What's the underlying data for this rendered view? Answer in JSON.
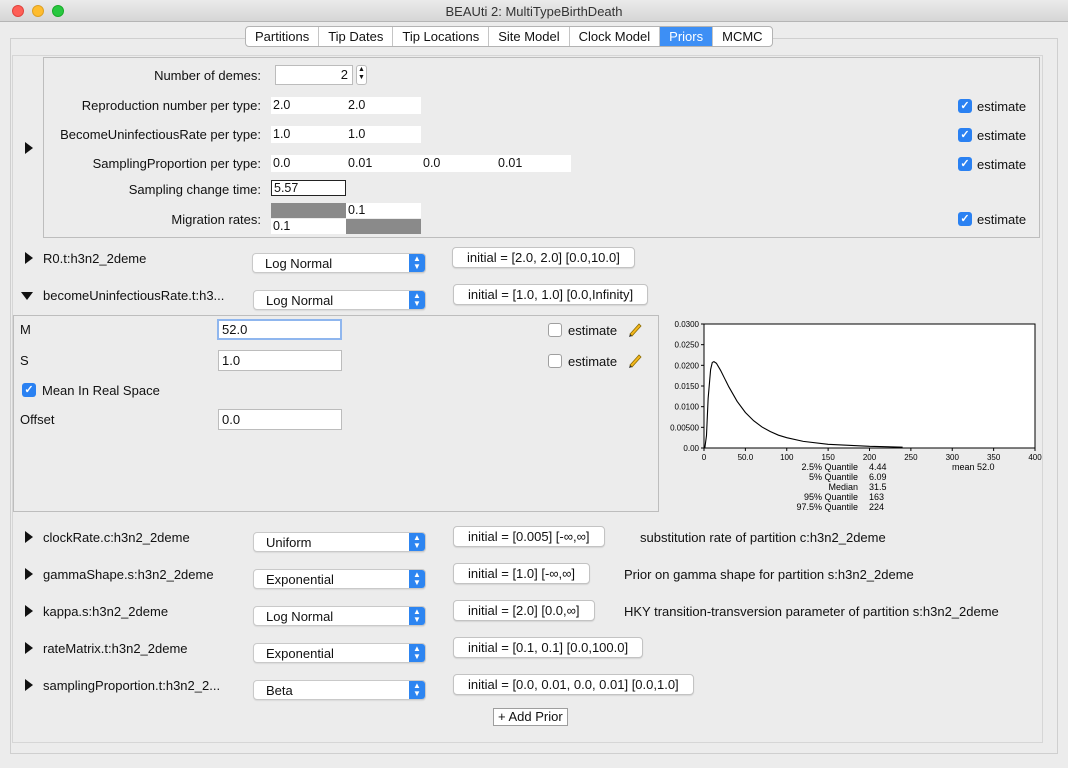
{
  "window": {
    "title": "BEAUti 2: MultiTypeBirthDeath"
  },
  "tabs": [
    "Partitions",
    "Tip Dates",
    "Tip Locations",
    "Site Model",
    "Clock Model",
    "Priors",
    "MCMC"
  ],
  "selected_tab": "Priors",
  "tree_prior": {
    "num_demes_label": "Number of demes:",
    "num_demes_value": "2",
    "r0_label": "Reproduction number per type:",
    "r0_values": [
      "2.0",
      "2.0"
    ],
    "become_label": "BecomeUninfectiousRate per type:",
    "become_values": [
      "1.0",
      "1.0"
    ],
    "sampling_label": "SamplingProportion per type:",
    "sampling_values": [
      "0.0",
      "0.01",
      "0.0",
      "0.01"
    ],
    "change_time_label": "Sampling change time:",
    "change_time_value": "5.57",
    "migration_label": "Migration rates:",
    "migration_values": [
      "0.1",
      "0.1"
    ],
    "estimate_label": "estimate"
  },
  "priors": [
    {
      "name": "R0.t:h3n2_2deme",
      "dist": "Log Normal",
      "initial": "initial = [2.0, 2.0] [0.0,10.0]",
      "desc": ""
    },
    {
      "name": "becomeUninfectiousRate.t:h3...",
      "dist": "Log Normal",
      "initial": "initial = [1.0, 1.0] [0.0,Infinity]",
      "desc": ""
    },
    {
      "name": "clockRate.c:h3n2_2deme",
      "dist": "Uniform",
      "initial": "initial = [0.005] [-∞,∞]",
      "desc": "substitution rate of partition c:h3n2_2deme"
    },
    {
      "name": "gammaShape.s:h3n2_2deme",
      "dist": "Exponential",
      "initial": "initial = [1.0] [-∞,∞]",
      "desc": "Prior on gamma shape for partition s:h3n2_2deme"
    },
    {
      "name": "kappa.s:h3n2_2deme",
      "dist": "Log Normal",
      "initial": "initial = [2.0] [0.0,∞]",
      "desc": "HKY transition-transversion parameter of partition s:h3n2_2deme"
    },
    {
      "name": "rateMatrix.t:h3n2_2deme",
      "dist": "Exponential",
      "initial": "initial = [0.1, 0.1] [0.0,100.0]",
      "desc": ""
    },
    {
      "name": "samplingProportion.t:h3n2_2...",
      "dist": "Beta",
      "initial": "initial = [0.0, 0.01, 0.0, 0.01] [0.0,1.0]",
      "desc": ""
    }
  ],
  "lognormal_panel": {
    "m_label": "M",
    "m_value": "52.0",
    "s_label": "S",
    "s_value": "1.0",
    "mean_real_label": "Mean In Real Space",
    "offset_label": "Offset",
    "offset_value": "0.0",
    "estimate_label": "estimate"
  },
  "chart_data": {
    "type": "line",
    "title": "",
    "xlabel": "",
    "ylabel": "",
    "xlim": [
      0,
      400
    ],
    "ylim": [
      0,
      0.03
    ],
    "x_ticks": [
      "0",
      "50.0",
      "100",
      "150",
      "200",
      "250",
      "300",
      "350",
      "400"
    ],
    "y_ticks": [
      "0.00",
      "0.00500",
      "0.0100",
      "0.0150",
      "0.0200",
      "0.0250",
      "0.0300"
    ],
    "series": [
      {
        "x": [
          1,
          3,
          5,
          8,
          10,
          12,
          15,
          20,
          25,
          30,
          40,
          50,
          60,
          70,
          80,
          90,
          100,
          120,
          150,
          200,
          240
        ],
        "y": [
          0.0,
          0.003,
          0.012,
          0.019,
          0.0207,
          0.0209,
          0.0205,
          0.0188,
          0.0168,
          0.0148,
          0.0113,
          0.0086,
          0.0066,
          0.0051,
          0.004,
          0.0031,
          0.0025,
          0.0016,
          0.0009,
          0.0004,
          0.0002
        ]
      }
    ],
    "quantiles": [
      {
        "label": "2.5% Quantile",
        "value": "4.44"
      },
      {
        "label": "5% Quantile",
        "value": "6.09"
      },
      {
        "label": "Median",
        "value": "31.5"
      },
      {
        "label": "95% Quantile",
        "value": "163"
      },
      {
        "label": "97.5% Quantile",
        "value": "224"
      }
    ],
    "mean_text": "mean 52.0"
  },
  "add_prior_label": "+ Add Prior",
  "colors": {
    "accent": "#2d85f1",
    "selected_tab": "#3d8ff5"
  }
}
